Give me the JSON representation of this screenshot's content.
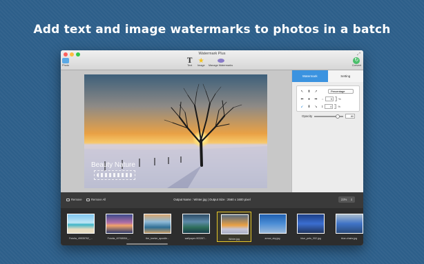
{
  "headline": "Add text and image watermarks to photos in a batch",
  "window": {
    "title": "Watermark Plus",
    "toolbar": {
      "photo_label": "Photo",
      "text_label": "Text",
      "image_label": "Image",
      "manage_label": "Manage Watermarks",
      "convert_label": "Convert"
    }
  },
  "preview": {
    "watermark_text": "Beauty Nature"
  },
  "panel": {
    "tabs": [
      "Watermark",
      "Setting"
    ],
    "active_tab": "Watermark",
    "position_mode": "Percentage",
    "x_value": "5",
    "y_value": "4",
    "percent_symbol": "%",
    "opacity_label": "Opacity",
    "opacity_value": "80"
  },
  "bottom_bar": {
    "remove_label": "Remove",
    "remove_all_label": "Remove All",
    "output_info": "Output Name : Winter.jpg  |  Output Size : 2560 x 1600 pixel",
    "zoom": "23%"
  },
  "thumbnails": [
    {
      "caption": "Fotolia_49535762_...",
      "selected": false
    },
    {
      "caption": "Fotolia_49768954_...",
      "selected": false
    },
    {
      "caption": "the_twelve_apostle...",
      "selected": false
    },
    {
      "caption": "wallpaper-903267...",
      "selected": false
    },
    {
      "caption": "Winter.jpg",
      "selected": true
    },
    {
      "caption": "arrow_sky.jpg",
      "selected": false
    },
    {
      "caption": "blue_pets_002.jpg",
      "selected": false
    },
    {
      "caption": "blue-chairs.jpg",
      "selected": false
    }
  ],
  "colors": {
    "background": "#2d5f8a",
    "accent_tab": "#3b93e0",
    "selection": "#e6c628"
  }
}
